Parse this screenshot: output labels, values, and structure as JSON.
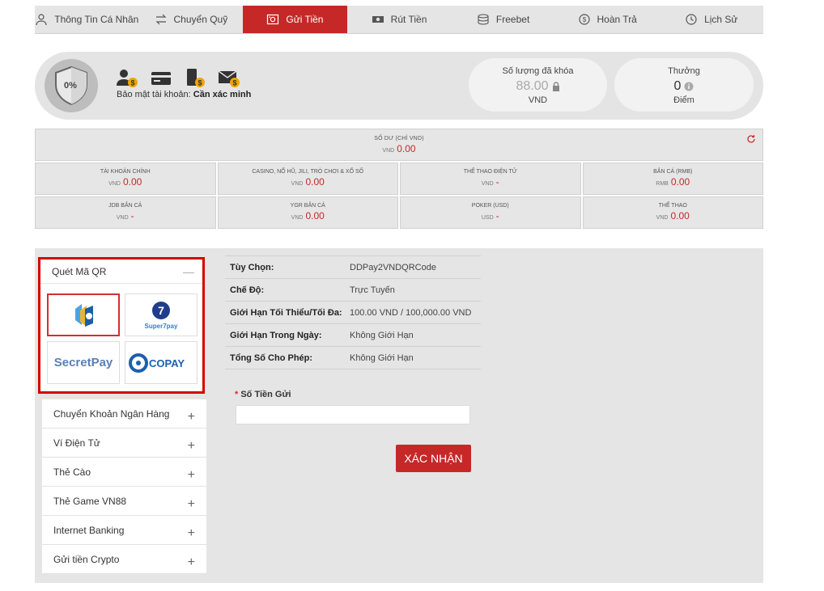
{
  "tabs": [
    {
      "label": "Thông Tin Cá Nhân",
      "icon": "user-icon"
    },
    {
      "label": "Chuyển Quỹ",
      "icon": "transfer-icon"
    },
    {
      "label": "Gửi Tiền",
      "icon": "deposit-icon"
    },
    {
      "label": "Rút Tiền",
      "icon": "withdraw-icon"
    },
    {
      "label": "Freebet",
      "icon": "coins-icon"
    },
    {
      "label": "Hoàn Trả",
      "icon": "rebate-icon"
    },
    {
      "label": "Lịch Sử",
      "icon": "history-icon"
    }
  ],
  "active_tab": "Gửi Tiền",
  "security": {
    "percent": "0%",
    "status_label": "Bảo mật tài khoản:",
    "status_value": "Cần xác minh",
    "icons": [
      "user-verify-icon",
      "card-verify-icon",
      "phone-verify-icon",
      "email-verify-icon"
    ]
  },
  "locked": {
    "label": "Số lượng đã khóa",
    "value": "88.00",
    "unit": "VND"
  },
  "reward": {
    "label": "Thưởng",
    "value": "0",
    "unit": "Điểm"
  },
  "balance_main": {
    "title": "SỐ DƯ (CHỈ VND)",
    "currency": "VND",
    "value": "0.00"
  },
  "balances": [
    {
      "title": "TÀI KHOẢN CHÍNH",
      "currency": "VND",
      "value": "0.00"
    },
    {
      "title": "CASINO, NỔ HŨ, JILI, TRÒ CHƠI & XỔ SỐ",
      "currency": "VND",
      "value": "0.00"
    },
    {
      "title": "THỂ THAO ĐIỆN TỬ",
      "currency": "VND",
      "value": "-"
    },
    {
      "title": "BẮN CÁ (RMB)",
      "currency": "RMB",
      "value": "0.00"
    },
    {
      "title": "JDB BẮN CÁ",
      "currency": "VND",
      "value": "-"
    },
    {
      "title": "YGR BẮN CÁ",
      "currency": "VND",
      "value": "0.00"
    },
    {
      "title": "POKER (USD)",
      "currency": "USD",
      "value": "-"
    },
    {
      "title": "THỂ THAO",
      "currency": "VND",
      "value": "0.00"
    }
  ],
  "qr_group": {
    "label": "Quét Mã QR",
    "providers": [
      "DDPay",
      "Super7pay",
      "SecretPay",
      "COPAY"
    ]
  },
  "methods": [
    "Chuyển Khoản Ngân Hàng",
    "Ví Điện Tử",
    "Thẻ Cào",
    "Thẻ Game VN88",
    "Internet Banking",
    "Gửi tiền Crypto"
  ],
  "details": [
    {
      "key": "Tùy Chọn:",
      "value": "DDPay2VNDQRCode"
    },
    {
      "key": "Chế Độ:",
      "value": "Trực Tuyến"
    },
    {
      "key": "Giới Hạn Tối Thiểu/Tối Đa:",
      "value": "100.00 VND / 100,000.00 VND"
    },
    {
      "key": "Giới Hạn Trong Ngày:",
      "value": "Không Giới Hạn"
    },
    {
      "key": "Tổng Số Cho Phép:",
      "value": "Không Giới Hạn"
    }
  ],
  "amount": {
    "required_mark": "*",
    "label": "Số Tiền Gửi",
    "value": "",
    "placeholder": ""
  },
  "submit_label": "XÁC NHẬN",
  "colors": {
    "accent": "#c62828",
    "panel": "#e5e5e5"
  }
}
